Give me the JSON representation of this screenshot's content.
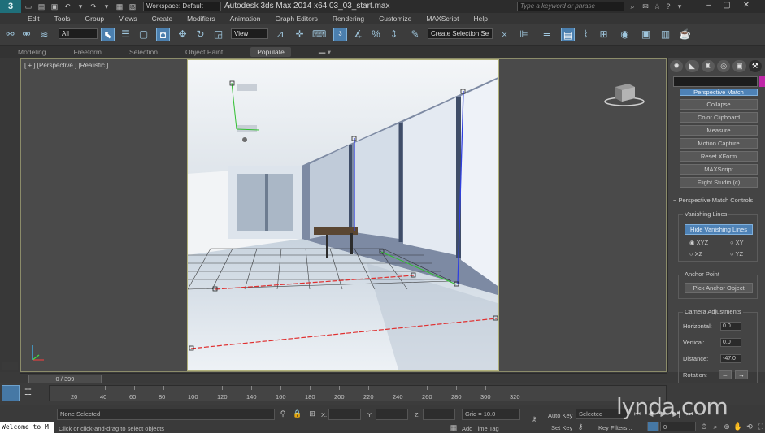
{
  "title_bar": {
    "logo_letter": "3",
    "workspace": "Workspace: Default",
    "app_title": "Autodesk 3ds Max  2014 x64   03_03_start.max",
    "search_placeholder": "Type a keyword or phrase"
  },
  "menus": [
    "Edit",
    "Tools",
    "Group",
    "Views",
    "Create",
    "Modifiers",
    "Animation",
    "Graph Editors",
    "Rendering",
    "Customize",
    "MAXScript",
    "Help"
  ],
  "toolbar": {
    "filter_combo": "All",
    "view_combo": "View",
    "selection_set_combo": "Create Selection Se"
  },
  "ribbon_tabs": [
    "Modeling",
    "Freeform",
    "Selection",
    "Object Paint",
    "Populate"
  ],
  "viewport": {
    "label": "[ + ] [Perspective ] [Realistic ]"
  },
  "command_panel": {
    "top_button": "Perspective Match",
    "utilities": [
      "Collapse",
      "Color Clipboard",
      "Measure",
      "Motion Capture",
      "Reset XForm",
      "MAXScript",
      "Flight Studio (c)"
    ],
    "rollout_title": "Perspective Match Controls",
    "vanishing_lines": {
      "label": "Vanishing Lines",
      "hide_button": "Hide Vanishing Lines",
      "radios": [
        "XYZ",
        "XY",
        "XZ",
        "YZ"
      ]
    },
    "anchor_point": {
      "label": "Anchor Point",
      "pick_button": "Pick Anchor Object"
    },
    "camera_adjustments": {
      "label": "Camera Adjustments",
      "horizontal_label": "Horizontal:",
      "horizontal_value": "0.0",
      "vertical_label": "Vertical:",
      "vertical_value": "0.0",
      "distance_label": "Distance:",
      "distance_value": "-47.0",
      "rotation_label": "Rotation:"
    }
  },
  "time_slider": {
    "frame": "0 / 399"
  },
  "track_bar": {
    "ticks": [
      "20",
      "40",
      "60",
      "80",
      "100",
      "120",
      "140",
      "160",
      "180",
      "200",
      "220",
      "240",
      "260",
      "280",
      "300",
      "320"
    ]
  },
  "status_bar": {
    "maxscript_listener": "Welcome to M",
    "selection_status": "None Selected",
    "prompt": "Click or click-and-drag to select objects",
    "x_label": "X:",
    "y_label": "Y:",
    "z_label": "Z:",
    "grid": "Grid = 10.0",
    "add_time_tag": "Add Time Tag",
    "auto_key": "Auto Key",
    "set_key": "Set Key",
    "selected_combo": "Selected",
    "key_filters": "Key Filters...",
    "frame_field": "0"
  },
  "watermark": "lynda.com",
  "colors": {
    "accent": "#4e82b6",
    "highlight_magenta": "#c026a8",
    "vanishing_red": "#e03030",
    "vanishing_green": "#30c030",
    "vanishing_blue": "#3040e0"
  }
}
